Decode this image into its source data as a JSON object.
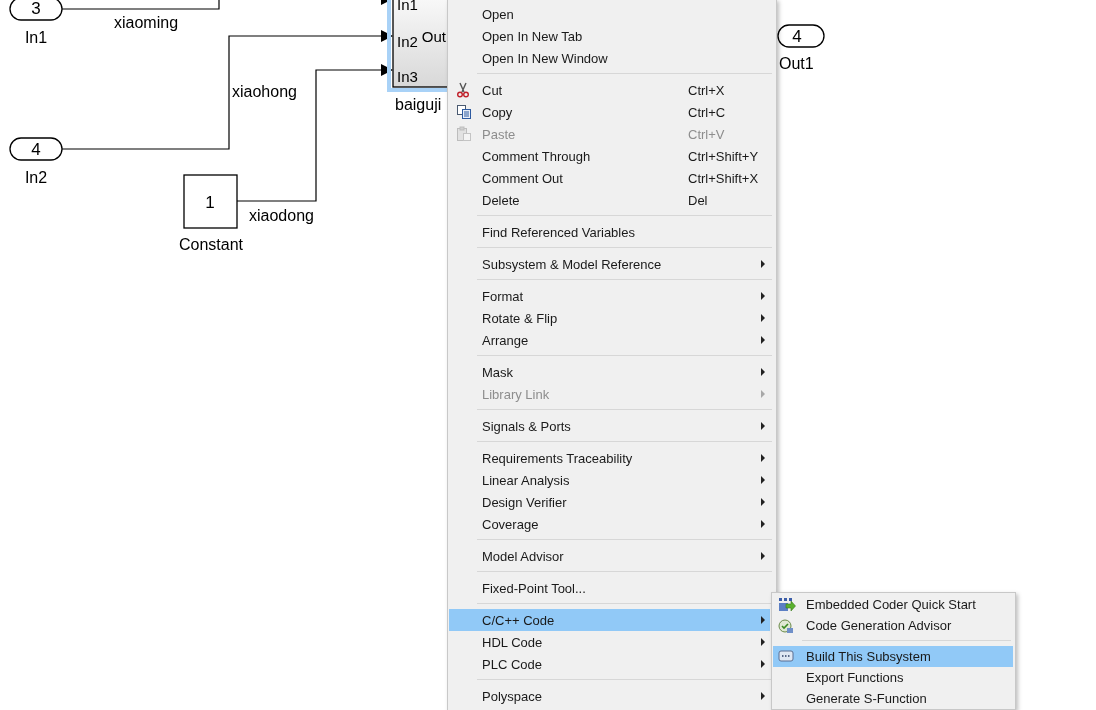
{
  "diagram": {
    "inports": [
      {
        "number": "3",
        "label": "In1"
      },
      {
        "number": "4",
        "label": "In2"
      }
    ],
    "constant": {
      "value": "1",
      "label": "Constant"
    },
    "signals": [
      {
        "label": "xiaoming"
      },
      {
        "label": "xiaohong"
      },
      {
        "label": "xiaodong"
      }
    ],
    "subsystem": {
      "name": "baiguji",
      "selected": true,
      "inputs": [
        "In1",
        "In2",
        "In3"
      ],
      "output": "Out"
    },
    "outport": {
      "number": "4",
      "label": "Out1"
    }
  },
  "context_menu": {
    "sections": [
      {
        "items": [
          {
            "label": "Open",
            "submenu": false,
            "disabled": false,
            "selected": false
          },
          {
            "label": "Open In New Tab",
            "submenu": false,
            "disabled": false,
            "selected": false
          },
          {
            "label": "Open In New Window",
            "submenu": false,
            "disabled": false,
            "selected": false
          }
        ]
      },
      {
        "items": [
          {
            "label": "Cut",
            "shortcut": "Ctrl+X",
            "submenu": false,
            "disabled": false,
            "selected": false
          },
          {
            "label": "Copy",
            "shortcut": "Ctrl+C",
            "submenu": false,
            "disabled": false,
            "selected": false
          },
          {
            "label": "Paste",
            "shortcut": "Ctrl+V",
            "submenu": false,
            "disabled": true,
            "selected": false
          },
          {
            "label": "Comment Through",
            "shortcut": "Ctrl+Shift+Y",
            "submenu": false,
            "disabled": false,
            "selected": false
          },
          {
            "label": "Comment Out",
            "shortcut": "Ctrl+Shift+X",
            "submenu": false,
            "disabled": false,
            "selected": false
          },
          {
            "label": "Delete",
            "shortcut": "Del",
            "submenu": false,
            "disabled": false,
            "selected": false
          }
        ]
      },
      {
        "items": [
          {
            "label": "Find Referenced Variables",
            "submenu": false,
            "disabled": false,
            "selected": false
          }
        ]
      },
      {
        "items": [
          {
            "label": "Subsystem & Model Reference",
            "submenu": true,
            "disabled": false,
            "selected": false
          }
        ]
      },
      {
        "items": [
          {
            "label": "Format",
            "submenu": true,
            "disabled": false,
            "selected": false
          },
          {
            "label": "Rotate & Flip",
            "submenu": true,
            "disabled": false,
            "selected": false
          },
          {
            "label": "Arrange",
            "submenu": true,
            "disabled": false,
            "selected": false
          }
        ]
      },
      {
        "items": [
          {
            "label": "Mask",
            "submenu": true,
            "disabled": false,
            "selected": false
          },
          {
            "label": "Library Link",
            "submenu": true,
            "disabled": true,
            "selected": false
          }
        ]
      },
      {
        "items": [
          {
            "label": "Signals & Ports",
            "submenu": true,
            "disabled": false,
            "selected": false
          }
        ]
      },
      {
        "items": [
          {
            "label": "Requirements Traceability",
            "submenu": true,
            "disabled": false,
            "selected": false
          },
          {
            "label": "Linear Analysis",
            "submenu": true,
            "disabled": false,
            "selected": false
          },
          {
            "label": "Design Verifier",
            "submenu": true,
            "disabled": false,
            "selected": false
          },
          {
            "label": "Coverage",
            "submenu": true,
            "disabled": false,
            "selected": false
          }
        ]
      },
      {
        "items": [
          {
            "label": "Model Advisor",
            "submenu": true,
            "disabled": false,
            "selected": false
          }
        ]
      },
      {
        "items": [
          {
            "label": "Fixed-Point Tool...",
            "submenu": false,
            "disabled": false,
            "selected": false
          }
        ]
      },
      {
        "items": [
          {
            "label": "C/C++ Code",
            "submenu": true,
            "disabled": false,
            "selected": true
          },
          {
            "label": "HDL Code",
            "submenu": true,
            "disabled": false,
            "selected": false
          },
          {
            "label": "PLC Code",
            "submenu": true,
            "disabled": false,
            "selected": false
          }
        ]
      },
      {
        "items": [
          {
            "label": "Polyspace",
            "submenu": true,
            "disabled": false,
            "selected": false
          }
        ]
      }
    ]
  },
  "submenu": {
    "sections": [
      {
        "items": [
          {
            "label": "Embedded Coder Quick Start",
            "selected": false
          },
          {
            "label": "Code Generation Advisor",
            "selected": false
          }
        ]
      },
      {
        "items": [
          {
            "label": "Build This Subsystem",
            "selected": true
          },
          {
            "label": "Export Functions",
            "selected": false
          },
          {
            "label": "Generate S-Function",
            "selected": false
          }
        ]
      }
    ]
  }
}
